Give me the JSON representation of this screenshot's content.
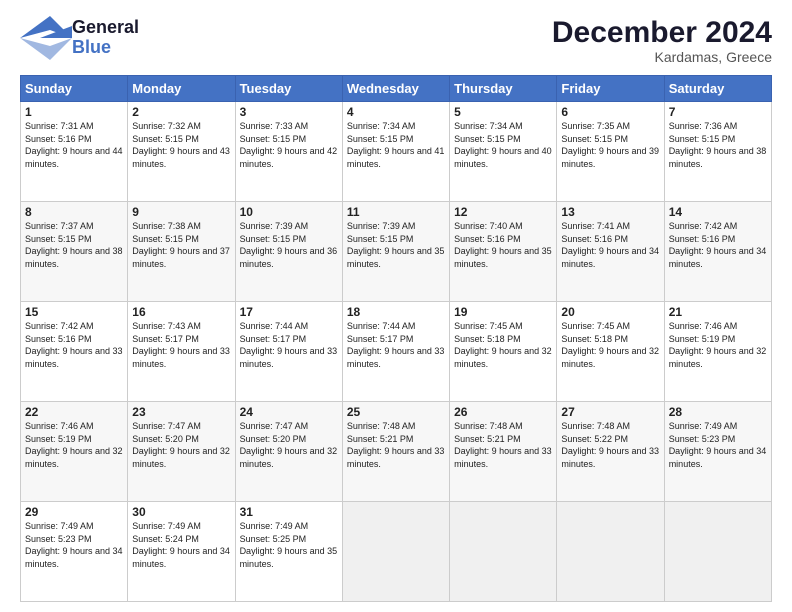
{
  "header": {
    "logo_general": "General",
    "logo_blue": "Blue",
    "month_title": "December 2024",
    "location": "Kardamas, Greece"
  },
  "days_of_week": [
    "Sunday",
    "Monday",
    "Tuesday",
    "Wednesday",
    "Thursday",
    "Friday",
    "Saturday"
  ],
  "weeks": [
    [
      {
        "day": "1",
        "sunrise": "7:31 AM",
        "sunset": "5:16 PM",
        "daylight": "9 hours and 44 minutes."
      },
      {
        "day": "2",
        "sunrise": "7:32 AM",
        "sunset": "5:15 PM",
        "daylight": "9 hours and 43 minutes."
      },
      {
        "day": "3",
        "sunrise": "7:33 AM",
        "sunset": "5:15 PM",
        "daylight": "9 hours and 42 minutes."
      },
      {
        "day": "4",
        "sunrise": "7:34 AM",
        "sunset": "5:15 PM",
        "daylight": "9 hours and 41 minutes."
      },
      {
        "day": "5",
        "sunrise": "7:34 AM",
        "sunset": "5:15 PM",
        "daylight": "9 hours and 40 minutes."
      },
      {
        "day": "6",
        "sunrise": "7:35 AM",
        "sunset": "5:15 PM",
        "daylight": "9 hours and 39 minutes."
      },
      {
        "day": "7",
        "sunrise": "7:36 AM",
        "sunset": "5:15 PM",
        "daylight": "9 hours and 38 minutes."
      }
    ],
    [
      {
        "day": "8",
        "sunrise": "7:37 AM",
        "sunset": "5:15 PM",
        "daylight": "9 hours and 38 minutes."
      },
      {
        "day": "9",
        "sunrise": "7:38 AM",
        "sunset": "5:15 PM",
        "daylight": "9 hours and 37 minutes."
      },
      {
        "day": "10",
        "sunrise": "7:39 AM",
        "sunset": "5:15 PM",
        "daylight": "9 hours and 36 minutes."
      },
      {
        "day": "11",
        "sunrise": "7:39 AM",
        "sunset": "5:15 PM",
        "daylight": "9 hours and 35 minutes."
      },
      {
        "day": "12",
        "sunrise": "7:40 AM",
        "sunset": "5:16 PM",
        "daylight": "9 hours and 35 minutes."
      },
      {
        "day": "13",
        "sunrise": "7:41 AM",
        "sunset": "5:16 PM",
        "daylight": "9 hours and 34 minutes."
      },
      {
        "day": "14",
        "sunrise": "7:42 AM",
        "sunset": "5:16 PM",
        "daylight": "9 hours and 34 minutes."
      }
    ],
    [
      {
        "day": "15",
        "sunrise": "7:42 AM",
        "sunset": "5:16 PM",
        "daylight": "9 hours and 33 minutes."
      },
      {
        "day": "16",
        "sunrise": "7:43 AM",
        "sunset": "5:17 PM",
        "daylight": "9 hours and 33 minutes."
      },
      {
        "day": "17",
        "sunrise": "7:44 AM",
        "sunset": "5:17 PM",
        "daylight": "9 hours and 33 minutes."
      },
      {
        "day": "18",
        "sunrise": "7:44 AM",
        "sunset": "5:17 PM",
        "daylight": "9 hours and 33 minutes."
      },
      {
        "day": "19",
        "sunrise": "7:45 AM",
        "sunset": "5:18 PM",
        "daylight": "9 hours and 32 minutes."
      },
      {
        "day": "20",
        "sunrise": "7:45 AM",
        "sunset": "5:18 PM",
        "daylight": "9 hours and 32 minutes."
      },
      {
        "day": "21",
        "sunrise": "7:46 AM",
        "sunset": "5:19 PM",
        "daylight": "9 hours and 32 minutes."
      }
    ],
    [
      {
        "day": "22",
        "sunrise": "7:46 AM",
        "sunset": "5:19 PM",
        "daylight": "9 hours and 32 minutes."
      },
      {
        "day": "23",
        "sunrise": "7:47 AM",
        "sunset": "5:20 PM",
        "daylight": "9 hours and 32 minutes."
      },
      {
        "day": "24",
        "sunrise": "7:47 AM",
        "sunset": "5:20 PM",
        "daylight": "9 hours and 32 minutes."
      },
      {
        "day": "25",
        "sunrise": "7:48 AM",
        "sunset": "5:21 PM",
        "daylight": "9 hours and 33 minutes."
      },
      {
        "day": "26",
        "sunrise": "7:48 AM",
        "sunset": "5:21 PM",
        "daylight": "9 hours and 33 minutes."
      },
      {
        "day": "27",
        "sunrise": "7:48 AM",
        "sunset": "5:22 PM",
        "daylight": "9 hours and 33 minutes."
      },
      {
        "day": "28",
        "sunrise": "7:49 AM",
        "sunset": "5:23 PM",
        "daylight": "9 hours and 34 minutes."
      }
    ],
    [
      {
        "day": "29",
        "sunrise": "7:49 AM",
        "sunset": "5:23 PM",
        "daylight": "9 hours and 34 minutes."
      },
      {
        "day": "30",
        "sunrise": "7:49 AM",
        "sunset": "5:24 PM",
        "daylight": "9 hours and 34 minutes."
      },
      {
        "day": "31",
        "sunrise": "7:49 AM",
        "sunset": "5:25 PM",
        "daylight": "9 hours and 35 minutes."
      },
      null,
      null,
      null,
      null
    ]
  ],
  "labels": {
    "sunrise": "Sunrise:",
    "sunset": "Sunset:",
    "daylight": "Daylight:"
  }
}
